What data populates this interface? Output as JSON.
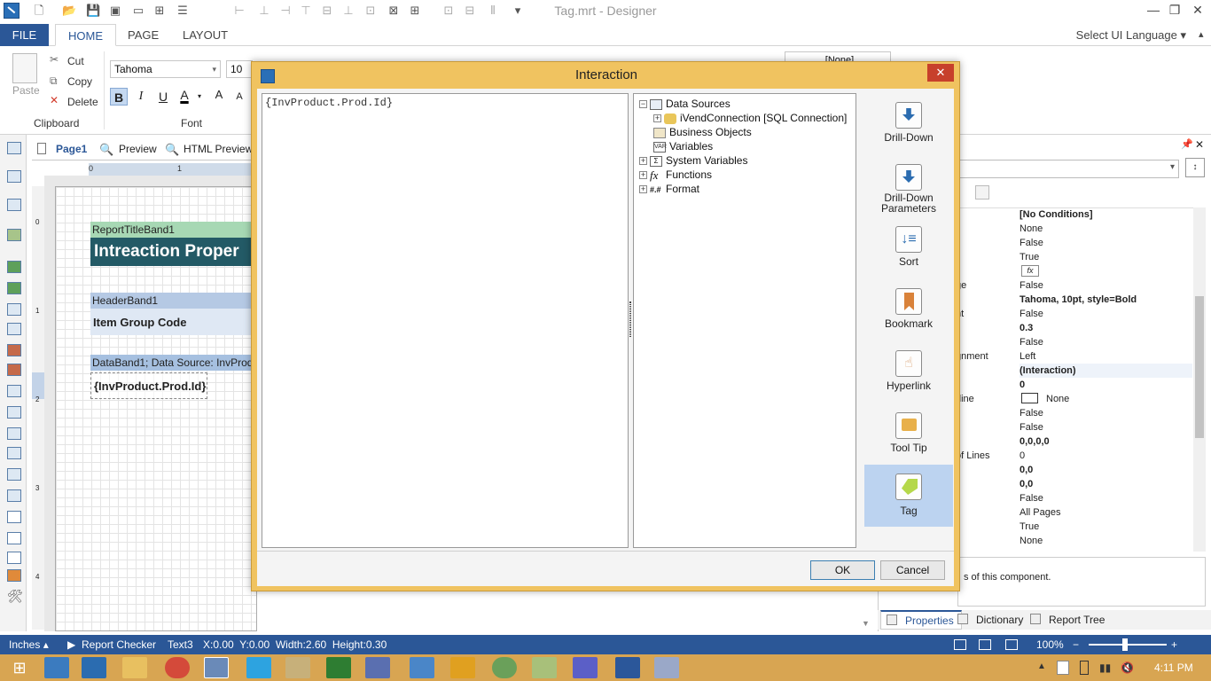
{
  "window": {
    "title": "Tag.mrt - Designer",
    "select_language": "Select UI Language"
  },
  "ribbon": {
    "tabs": [
      "FILE",
      "HOME",
      "PAGE",
      "LAYOUT"
    ],
    "clipboard": {
      "paste": "Paste",
      "cut": "Cut",
      "copy": "Copy",
      "delete": "Delete",
      "group": "Clipboard"
    },
    "font": {
      "family": "Tahoma",
      "size": "10",
      "group": "Font",
      "bold": "B",
      "italic": "I",
      "underline": "U",
      "color": "A",
      "grow": "A",
      "shrink": "A"
    },
    "style_value": "[None]"
  },
  "page_tabs": {
    "page1": "Page1",
    "preview": "Preview",
    "html_preview": "HTML Preview"
  },
  "ruler": {
    "h0": "0",
    "h1": "1",
    "v0": "0",
    "v1": "1",
    "v2": "2",
    "v3": "3",
    "v4": "4"
  },
  "report": {
    "title_band_label": "ReportTitleBand1",
    "title_text": "Intreaction Proper",
    "header_band_label": "HeaderBand1",
    "header_text": "Item Group Code",
    "data_band_label": "DataBand1; Data Source: InvProdu",
    "data_text": "{InvProduct.Prod.Id}"
  },
  "dialog": {
    "title": "Interaction",
    "close": "✕",
    "expression": "{InvProduct.Prod.Id}",
    "tree": {
      "data_sources": "Data Sources",
      "connection": "iVendConnection [SQL Connection]",
      "business_objects": "Business Objects",
      "variables": "Variables",
      "system_variables": "System Variables",
      "functions": "Functions",
      "format": "Format"
    },
    "side_items": [
      "Drill-Down",
      "Drill-Down Parameters",
      "Sort",
      "Bookmark",
      "Hyperlink",
      "Tool Tip",
      "Tag"
    ],
    "selected_side_item": "Tag",
    "ok": "OK",
    "cancel": "Cancel"
  },
  "properties": {
    "label_fragments": [
      "ge",
      "nt",
      "gnment",
      "rline",
      "of Lines"
    ],
    "values": [
      "[No Conditions]",
      "None",
      "False",
      "True",
      "fx",
      "False",
      "Tahoma, 10pt, style=Bold",
      "False",
      "0.3",
      "False",
      "Left",
      "(Interaction)",
      "0",
      "None",
      "False",
      "False",
      "0,0,0,0",
      "0",
      "0,0",
      "0,0",
      "False",
      "All Pages",
      "True",
      "None"
    ],
    "description": "s of this component.",
    "bottom_tabs": {
      "properties": "Properties",
      "dictionary": "Dictionary",
      "report_tree": "Report Tree"
    }
  },
  "statusbar": {
    "units": "Inches",
    "report_checker": "Report Checker",
    "component": "Text3",
    "position": "X:0.00  Y:0.00  Width:2.60  Height:0.30",
    "zoom": "100%"
  },
  "taskbar": {
    "clock": "4:11 PM"
  }
}
